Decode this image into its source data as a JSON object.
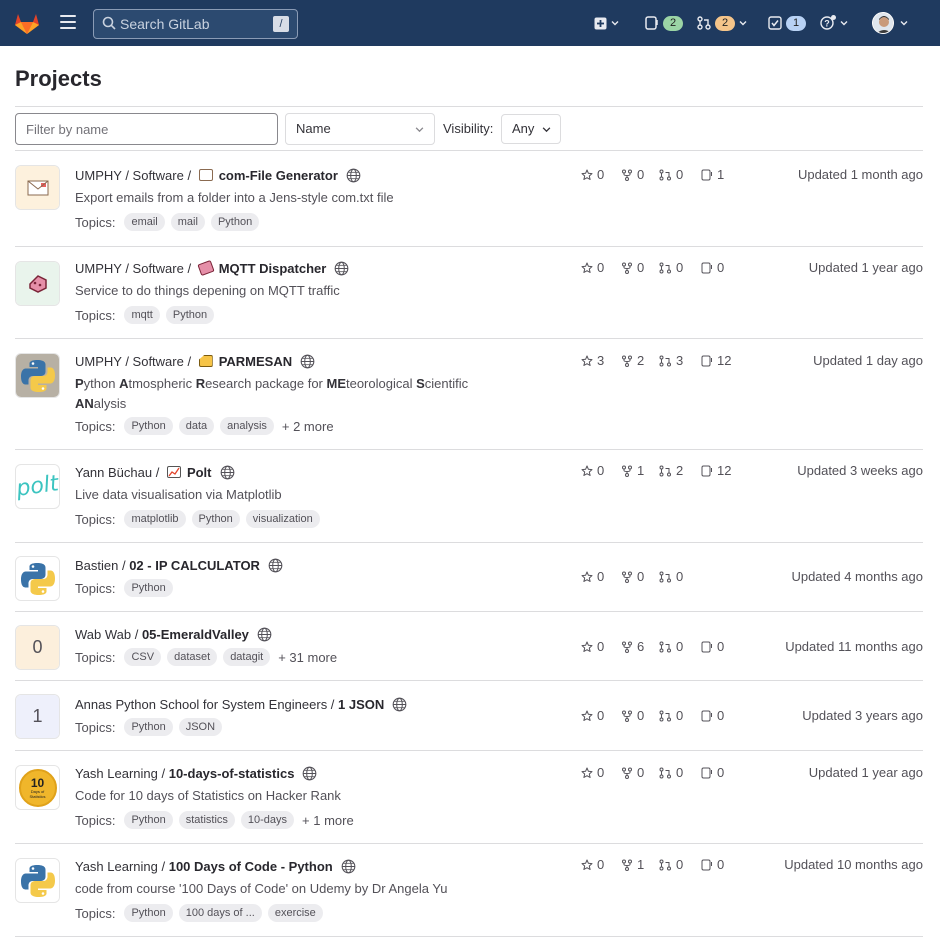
{
  "nav": {
    "search_placeholder": "Search GitLab",
    "search_shortcut": "/",
    "issues_count": "2",
    "merge_requests_count": "2",
    "todos_count": "1"
  },
  "page": {
    "title": "Projects",
    "filter_placeholder": "Filter by name",
    "sort_value": "Name",
    "visibility_label": "Visibility:",
    "visibility_value": "Any",
    "topics_label": "Topics:"
  },
  "projects": [
    {
      "namespace": "UMPHY / Software / ",
      "name": "com-File Generator",
      "description": "Export emails from a folder into a Jens-style com.txt file",
      "topics": [
        "email",
        "mail",
        "Python"
      ],
      "more": "",
      "stars": "0",
      "forks": "0",
      "merge_requests": "0",
      "issues": "1",
      "updated": "Updated 1 month ago"
    },
    {
      "namespace": "UMPHY / Software / ",
      "name": "MQTT Dispatcher",
      "description": "Service to do things depening on MQTT traffic",
      "topics": [
        "mqtt",
        "Python"
      ],
      "more": "",
      "stars": "0",
      "forks": "0",
      "merge_requests": "0",
      "issues": "0",
      "updated": "Updated 1 year ago"
    },
    {
      "namespace": "UMPHY / Software / ",
      "name": "PARMESAN",
      "description": "Python Atmospheric Research package for MEteorological Scientific ANalysis",
      "topics": [
        "Python",
        "data",
        "analysis"
      ],
      "more": "+ 2 more",
      "stars": "3",
      "forks": "2",
      "merge_requests": "3",
      "issues": "12",
      "updated": "Updated 1 day ago"
    },
    {
      "namespace": "Yann Büchau / ",
      "name": "Polt",
      "description": "Live data visualisation via Matplotlib",
      "topics": [
        "matplotlib",
        "Python",
        "visualization"
      ],
      "more": "",
      "stars": "0",
      "forks": "1",
      "merge_requests": "2",
      "issues": "12",
      "updated": "Updated 3 weeks ago"
    },
    {
      "namespace": "Bastien / ",
      "name": "02 - IP CALCULATOR",
      "description": "",
      "topics": [
        "Python"
      ],
      "more": "",
      "stars": "0",
      "forks": "0",
      "merge_requests": "0",
      "issues": "",
      "updated": "Updated 4 months ago"
    },
    {
      "namespace": "Wab Wab / ",
      "name": "05-EmeraldValley",
      "avatar_letter": "0",
      "description": "",
      "topics": [
        "CSV",
        "dataset",
        "datagit"
      ],
      "more": "+ 31 more",
      "stars": "0",
      "forks": "6",
      "merge_requests": "0",
      "issues": "0",
      "updated": "Updated 11 months ago"
    },
    {
      "namespace": "Annas Python School for System Engineers / ",
      "name": "1 JSON",
      "avatar_letter": "1",
      "description": "",
      "topics": [
        "Python",
        "JSON"
      ],
      "more": "",
      "stars": "0",
      "forks": "0",
      "merge_requests": "0",
      "issues": "0",
      "updated": "Updated 3 years ago"
    },
    {
      "namespace": "Yash Learning / ",
      "name": "10-days-of-statistics",
      "avatar_text": "10",
      "avatar_subtext": "Days of Statistics",
      "description": "Code for 10 days of Statistics on Hacker Rank",
      "topics": [
        "Python",
        "statistics",
        "10-days"
      ],
      "more": "+ 1 more",
      "stars": "0",
      "forks": "0",
      "merge_requests": "0",
      "issues": "0",
      "updated": "Updated 1 year ago"
    },
    {
      "namespace": "Yash Learning / ",
      "name": "100 Days of Code - Python",
      "description": "code from course '100 Days of Code' on Udemy by Dr Angela Yu",
      "topics": [
        "Python",
        "100 days of ...",
        "exercise"
      ],
      "more": "",
      "stars": "0",
      "forks": "1",
      "merge_requests": "0",
      "issues": "0",
      "updated": "Updated 10 months ago"
    }
  ],
  "colors": {
    "nav_bg": "#1f3a5f",
    "topic_bg": "#ececef",
    "python_blue": "#3a73a8",
    "python_yellow": "#f4c94a",
    "polt_teal": "#3cc4c0"
  }
}
